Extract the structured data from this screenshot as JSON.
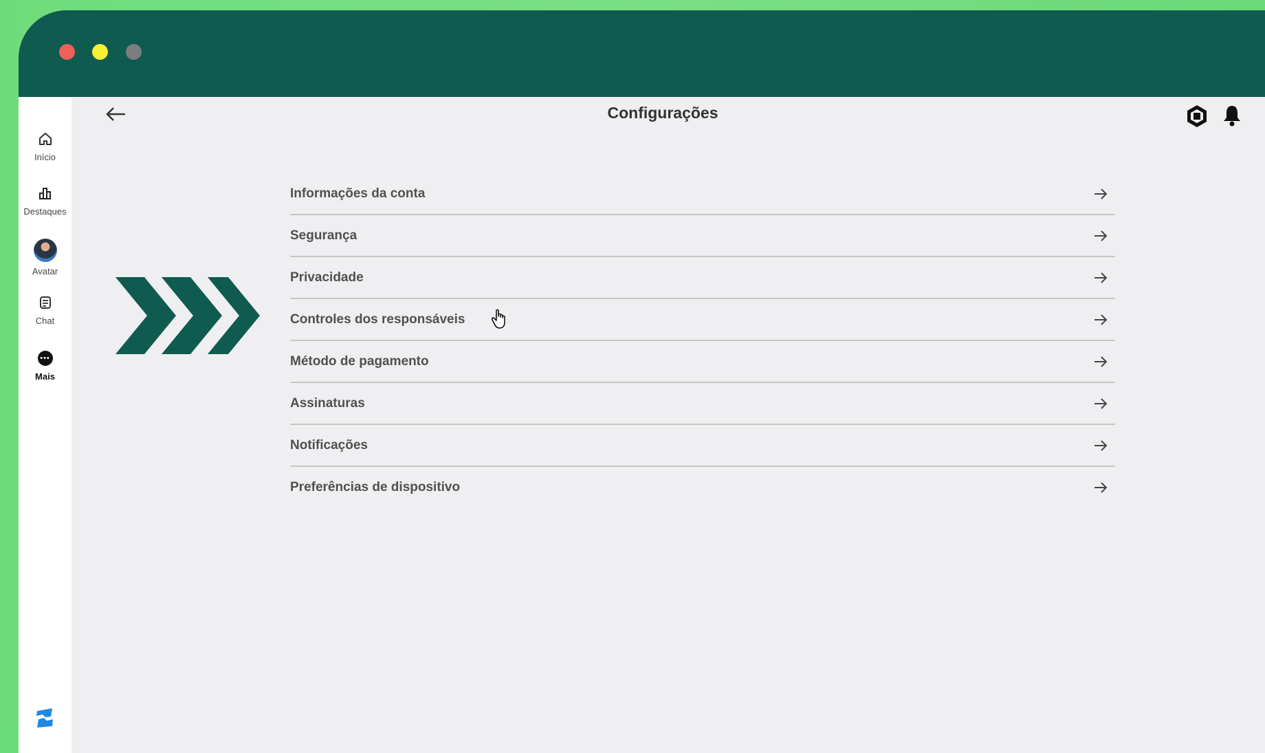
{
  "window": {
    "controls": [
      "close",
      "minimize",
      "maximize"
    ]
  },
  "sidebar": {
    "items": [
      {
        "label": "Início",
        "icon": "home-icon"
      },
      {
        "label": "Destaques",
        "icon": "chart-icon"
      },
      {
        "label": "Avatar",
        "icon": "avatar-icon"
      },
      {
        "label": "Chat",
        "icon": "chat-icon"
      },
      {
        "label": "Mais",
        "icon": "more-icon"
      }
    ],
    "logo": "roblox-studio-logo"
  },
  "header": {
    "title": "Configurações",
    "back_icon": "back-arrow-icon",
    "right_icons": [
      "robux-icon",
      "bell-icon"
    ]
  },
  "settings": {
    "items": [
      {
        "label": "Informações da conta"
      },
      {
        "label": "Segurança"
      },
      {
        "label": "Privacidade"
      },
      {
        "label": "Controles dos responsáveis"
      },
      {
        "label": "Método de pagamento"
      },
      {
        "label": "Assinaturas"
      },
      {
        "label": "Notificações"
      },
      {
        "label": "Preferências de dispositivo"
      }
    ]
  },
  "colors": {
    "background": "#6ddc7a",
    "window_frame": "#0f5b50",
    "content_bg": "#efeff2",
    "chevron": "#0f5b50"
  }
}
